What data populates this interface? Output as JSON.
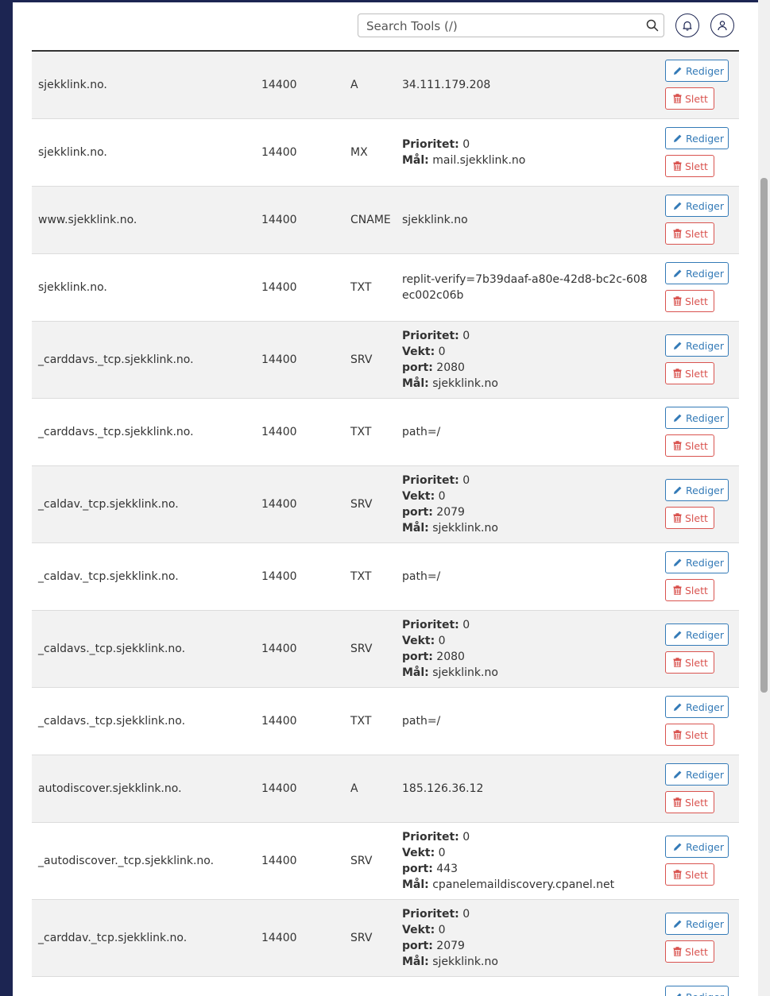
{
  "search": {
    "placeholder": "Search Tools (/)"
  },
  "icons": {
    "search": "search-icon",
    "bell": "bell-icon",
    "user": "user-icon",
    "edit": "pencil-icon",
    "delete": "trash-icon"
  },
  "colors": {
    "sidebar": "#1c2552",
    "edit": "#337ab7",
    "delete": "#d9534f"
  },
  "labels": {
    "edit": "Rediger",
    "delete": "Slett"
  },
  "records": [
    {
      "name": "sjekklink.no.",
      "ttl": "14400",
      "type": "A",
      "lines": [
        {
          "value": "34.111.179.208"
        }
      ]
    },
    {
      "name": "sjekklink.no.",
      "ttl": "14400",
      "type": "MX",
      "lines": [
        {
          "label": "Prioritet:",
          "value": "0"
        },
        {
          "label": "Mål:",
          "value": "mail.sjekklink.no"
        }
      ]
    },
    {
      "name": "www.sjekklink.no.",
      "ttl": "14400",
      "type": "CNAME",
      "lines": [
        {
          "value": "sjekklink.no"
        }
      ]
    },
    {
      "name": "sjekklink.no.",
      "ttl": "14400",
      "type": "TXT",
      "lines": [
        {
          "value": "replit-verify=7b39daaf-a80e-42d8-bc2c-608ec002c06b"
        }
      ]
    },
    {
      "name": "_carddavs._tcp.sjekklink.no.",
      "ttl": "14400",
      "type": "SRV",
      "lines": [
        {
          "label": "Prioritet:",
          "value": "0"
        },
        {
          "label": "Vekt:",
          "value": "0"
        },
        {
          "label": "port:",
          "value": "2080"
        },
        {
          "label": "Mål:",
          "value": "sjekklink.no"
        }
      ]
    },
    {
      "name": "_carddavs._tcp.sjekklink.no.",
      "ttl": "14400",
      "type": "TXT",
      "lines": [
        {
          "value": "path=/"
        }
      ]
    },
    {
      "name": "_caldav._tcp.sjekklink.no.",
      "ttl": "14400",
      "type": "SRV",
      "lines": [
        {
          "label": "Prioritet:",
          "value": "0"
        },
        {
          "label": "Vekt:",
          "value": "0"
        },
        {
          "label": "port:",
          "value": "2079"
        },
        {
          "label": "Mål:",
          "value": "sjekklink.no"
        }
      ]
    },
    {
      "name": "_caldav._tcp.sjekklink.no.",
      "ttl": "14400",
      "type": "TXT",
      "lines": [
        {
          "value": "path=/"
        }
      ]
    },
    {
      "name": "_caldavs._tcp.sjekklink.no.",
      "ttl": "14400",
      "type": "SRV",
      "lines": [
        {
          "label": "Prioritet:",
          "value": "0"
        },
        {
          "label": "Vekt:",
          "value": "0"
        },
        {
          "label": "port:",
          "value": "2080"
        },
        {
          "label": "Mål:",
          "value": "sjekklink.no"
        }
      ]
    },
    {
      "name": "_caldavs._tcp.sjekklink.no.",
      "ttl": "14400",
      "type": "TXT",
      "lines": [
        {
          "value": "path=/"
        }
      ]
    },
    {
      "name": "autodiscover.sjekklink.no.",
      "ttl": "14400",
      "type": "A",
      "lines": [
        {
          "value": "185.126.36.12"
        }
      ]
    },
    {
      "name": "_autodiscover._tcp.sjekklink.no.",
      "ttl": "14400",
      "type": "SRV",
      "lines": [
        {
          "label": "Prioritet:",
          "value": "0"
        },
        {
          "label": "Vekt:",
          "value": "0"
        },
        {
          "label": "port:",
          "value": "443"
        },
        {
          "label": "Mål:",
          "value": "cpanelemaildiscovery.cpanel.net"
        }
      ]
    },
    {
      "name": "_carddav._tcp.sjekklink.no.",
      "ttl": "14400",
      "type": "SRV",
      "lines": [
        {
          "label": "Prioritet:",
          "value": "0"
        },
        {
          "label": "Vekt:",
          "value": "0"
        },
        {
          "label": "port:",
          "value": "2079"
        },
        {
          "label": "Mål:",
          "value": "sjekklink.no"
        }
      ]
    }
  ],
  "partial_row": {
    "edit_label": "Rediger"
  }
}
